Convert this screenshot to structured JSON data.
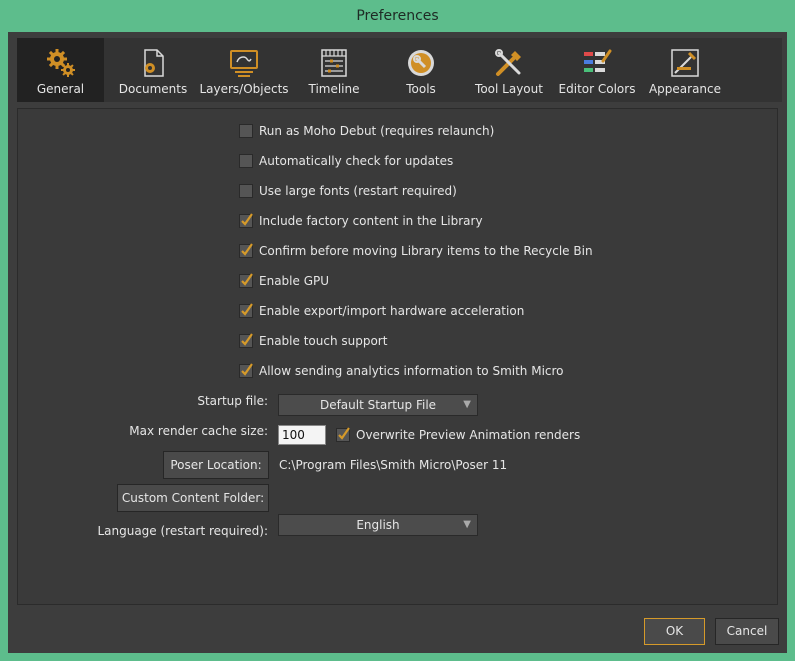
{
  "window": {
    "title": "Preferences"
  },
  "tabs": [
    {
      "label": "General",
      "icon": "gears-icon",
      "active": true
    },
    {
      "label": "Documents",
      "icon": "document-gear-icon"
    },
    {
      "label": "Layers/Objects",
      "icon": "layers-monitor-icon"
    },
    {
      "label": "Timeline",
      "icon": "timeline-icon"
    },
    {
      "label": "Tools",
      "icon": "tools-icon"
    },
    {
      "label": "Tool Layout",
      "icon": "tool-layout-icon"
    },
    {
      "label": "Editor Colors",
      "icon": "editor-colors-icon"
    },
    {
      "label": "Appearance",
      "icon": "appearance-icon"
    }
  ],
  "options": [
    {
      "label": "Run as Moho Debut (requires relaunch)",
      "checked": false
    },
    {
      "label": "Automatically check for updates",
      "checked": false
    },
    {
      "label": "Use large fonts (restart required)",
      "checked": false
    },
    {
      "label": "Include factory content in the Library",
      "checked": true
    },
    {
      "label": "Confirm before moving Library items to the Recycle Bin",
      "checked": true
    },
    {
      "label": "Enable GPU",
      "checked": true
    },
    {
      "label": "Enable export/import hardware acceleration",
      "checked": true
    },
    {
      "label": "Enable touch support",
      "checked": true
    },
    {
      "label": "Allow sending analytics information to Smith Micro",
      "checked": true
    }
  ],
  "startup": {
    "label": "Startup file:",
    "value": "Default Startup File"
  },
  "cache": {
    "label": "Max render cache size:",
    "value": "100",
    "overwrite_label": "Overwrite Preview Animation renders",
    "overwrite_checked": true
  },
  "poser": {
    "button": "Poser Location:",
    "path": "C:\\Program Files\\Smith Micro\\Poser 11"
  },
  "custom_content": {
    "button": "Custom Content Folder:"
  },
  "language": {
    "label": "Language (restart required):",
    "value": "English"
  },
  "footer": {
    "ok": "OK",
    "cancel": "Cancel"
  },
  "colors": {
    "accent": "#d59a2a",
    "frame": "#5dbd8c",
    "background": "#3d3d3d"
  }
}
